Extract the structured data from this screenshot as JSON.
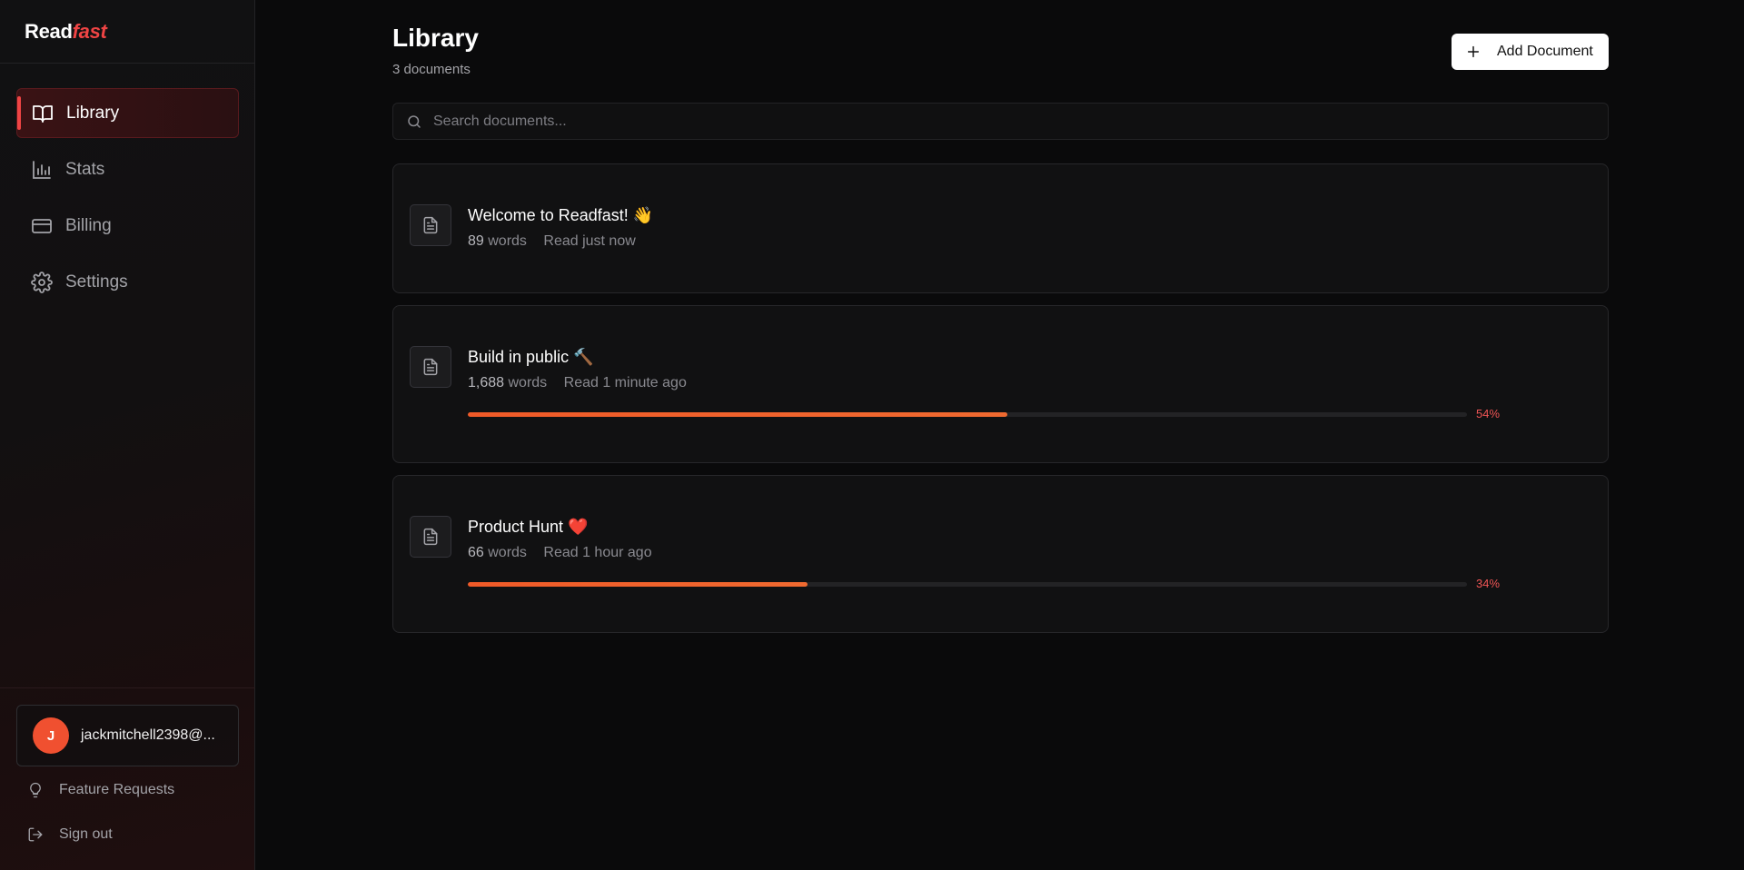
{
  "brand": {
    "name_part1": "Read",
    "name_part2": "fast"
  },
  "sidebar": {
    "items": [
      {
        "label": "Library",
        "icon": "book-open-icon",
        "active": true
      },
      {
        "label": "Stats",
        "icon": "bar-chart-icon",
        "active": false
      },
      {
        "label": "Billing",
        "icon": "credit-card-icon",
        "active": false
      },
      {
        "label": "Settings",
        "icon": "gear-icon",
        "active": false
      }
    ],
    "user": {
      "avatar_initial": "J",
      "email": "jackmitchell2398@..."
    },
    "feature_requests_label": "Feature Requests",
    "sign_out_label": "Sign out"
  },
  "main": {
    "title": "Library",
    "doc_count": "3 documents",
    "add_button_label": "Add Document",
    "search_placeholder": "Search documents...",
    "documents": [
      {
        "title": "Welcome to Readfast! 👋",
        "words": "89",
        "words_label": "words",
        "read": "Read just now",
        "progress": null,
        "progress_label": ""
      },
      {
        "title": "Build in public 🔨",
        "words": "1,688",
        "words_label": "words",
        "read": "Read 1 minute ago",
        "progress": 54,
        "progress_label": "54%"
      },
      {
        "title": "Product Hunt ❤️",
        "words": "66",
        "words_label": "words",
        "read": "Read 1 hour ago",
        "progress": 34,
        "progress_label": "34%"
      }
    ]
  },
  "colors": {
    "accent": "#ef4444",
    "progress": "#f05a28",
    "avatar": "#f05030"
  }
}
